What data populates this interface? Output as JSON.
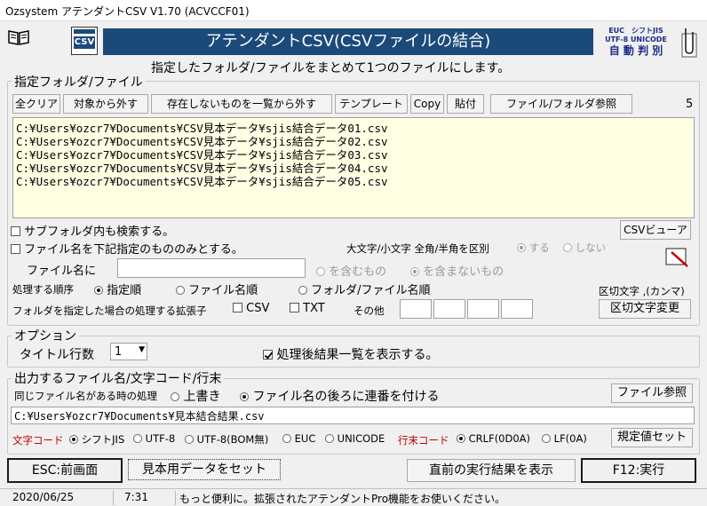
{
  "window": {
    "title": "Ozsystem アテンダントCSV V1.70 (ACVCCF01)"
  },
  "header": {
    "banner_title": "アテンダントCSV(CSVファイルの結合)",
    "subtitle": "指定したフォルダ/ファイルをまとめて1つのファイルにします。",
    "csv_icon_label": "CSV",
    "encoding_badge": {
      "line1": "EUC　シフトJIS",
      "line2": "UTF-8 UNICODE",
      "line3": "自 動 判 別"
    }
  },
  "folder_group": {
    "label": "指定フォルダ/ファイル",
    "buttons": {
      "clear_all": "全クリア",
      "remove_target": "対象から外す",
      "remove_missing": "存在しないものを一覧から外す",
      "template": "テンプレート",
      "copy": "Copy",
      "paste": "貼付",
      "browse": "ファイル/フォルダ参照"
    },
    "count": "5",
    "files": [
      "C:¥Users¥ozcr7¥Documents¥CSV見本データ¥sjis結合データ01.csv",
      "C:¥Users¥ozcr7¥Documents¥CSV見本データ¥sjis結合データ02.csv",
      "C:¥Users¥ozcr7¥Documents¥CSV見本データ¥sjis結合データ03.csv",
      "C:¥Users¥ozcr7¥Documents¥CSV見本データ¥sjis結合データ04.csv",
      "C:¥Users¥ozcr7¥Documents¥CSV見本データ¥sjis結合データ05.csv"
    ],
    "search_subfolders": "サブフォルダ内も検索する。",
    "filter_filename": "ファイル名を下記指定のもののみとする。",
    "csv_viewer": "CSVビューア",
    "case_label": "大文字/小文字 全角/半角を区別",
    "case_yes": "する",
    "case_no": "しない",
    "filename_label": "ファイル名に",
    "filename_value": "",
    "contains": "を含むもの",
    "not_contains": "を含まないもの",
    "order_label": "処理する順序",
    "order_specified": "指定順",
    "order_filename": "ファイル名順",
    "order_folder_filename": "フォルダ/ファイル名順",
    "ext_label": "フォルダを指定した場合の処理する拡張子",
    "ext_csv": "CSV",
    "ext_txt": "TXT",
    "ext_other": "その他",
    "delimiter_label": "区切文字 ,(カンマ)",
    "delimiter_change": "区切文字変更"
  },
  "options_group": {
    "label": "オプション",
    "title_rows_label": "タイトル行数",
    "title_rows_value": "1",
    "show_result": "処理後結果一覧を表示する。"
  },
  "output_group": {
    "label": "出力するファイル名/文字コード/行末",
    "same_name_label": "同じファイル名がある時の処理",
    "overwrite": "上書き",
    "append_number": "ファイル名の後ろに連番を付ける",
    "browse": "ファイル参照",
    "output_path": "C:¥Users¥ozcr7¥Documents¥見本結合結果.csv",
    "charset_label": "文字コード",
    "charsets": [
      "シフトJIS",
      "UTF-8",
      "UTF-8(BOM無)",
      "EUC",
      "UNICODE"
    ],
    "eol_label": "行末コード",
    "eols": [
      "CRLF(0D0A)",
      "LF(0A)"
    ],
    "defaults": "規定値セット"
  },
  "bottom": {
    "esc": "ESC:前画面",
    "sample": "見本用データをセット",
    "last_result": "直前の実行結果を表示",
    "run": "F12:実行"
  },
  "status": {
    "date": "2020/06/25",
    "time": "7:31",
    "message": "もっと便利に。拡張されたアテンダントPro機能をお使いください。"
  },
  "colors": {
    "banner": "#1b4a7a",
    "list_bg": "#ffffe4",
    "label_red": "#c00000"
  }
}
